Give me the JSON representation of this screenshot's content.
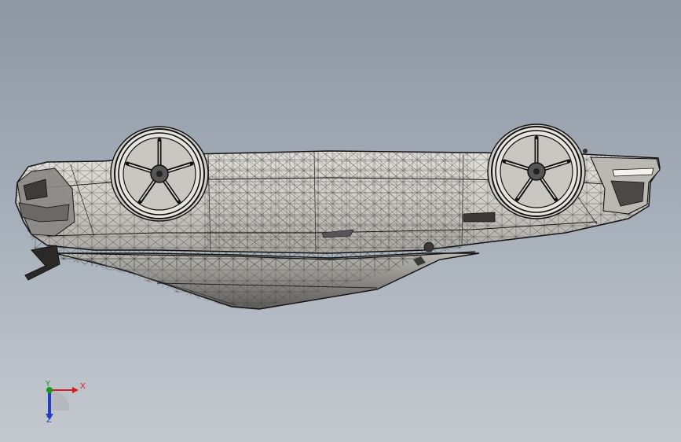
{
  "viewport": {
    "background_top": "#8d97a3",
    "background_bottom": "#c4c9cf",
    "model": {
      "name": "car-body-wireframe",
      "display_mode": "shaded-with-edges",
      "orientation": "upside-down",
      "body_color": "#d6d4cf",
      "edge_color": "#1c1c1c"
    }
  },
  "triad": {
    "x_label": "X",
    "y_label": "Y",
    "z_label": "Z",
    "x_color": "#d81d1d",
    "y_color": "#1a9a1a",
    "z_color": "#2040c0"
  }
}
